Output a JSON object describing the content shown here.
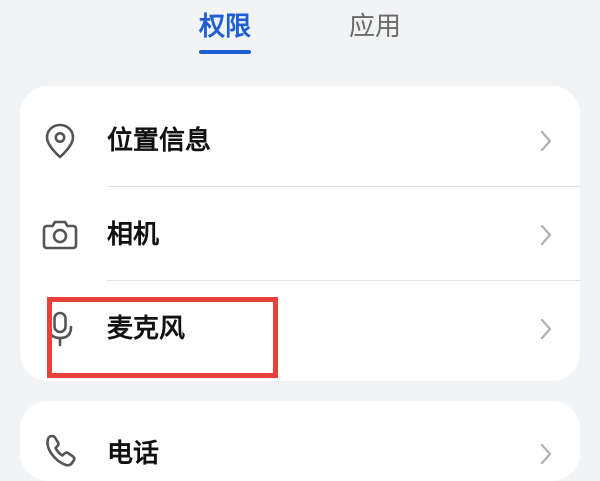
{
  "tabs": [
    {
      "label": "权限",
      "active": true
    },
    {
      "label": "应用",
      "active": false
    }
  ],
  "permissions": {
    "items": [
      {
        "label": "位置信息",
        "icon": "location-pin-icon"
      },
      {
        "label": "相机",
        "icon": "camera-icon"
      },
      {
        "label": "麦克风",
        "icon": "microphone-icon"
      }
    ],
    "next_items": [
      {
        "label": "电话",
        "icon": "phone-icon"
      }
    ]
  },
  "colors": {
    "accent": "#1f5fd6",
    "highlight": "#e8413a",
    "background": "#f1f3f5",
    "card": "#ffffff"
  }
}
